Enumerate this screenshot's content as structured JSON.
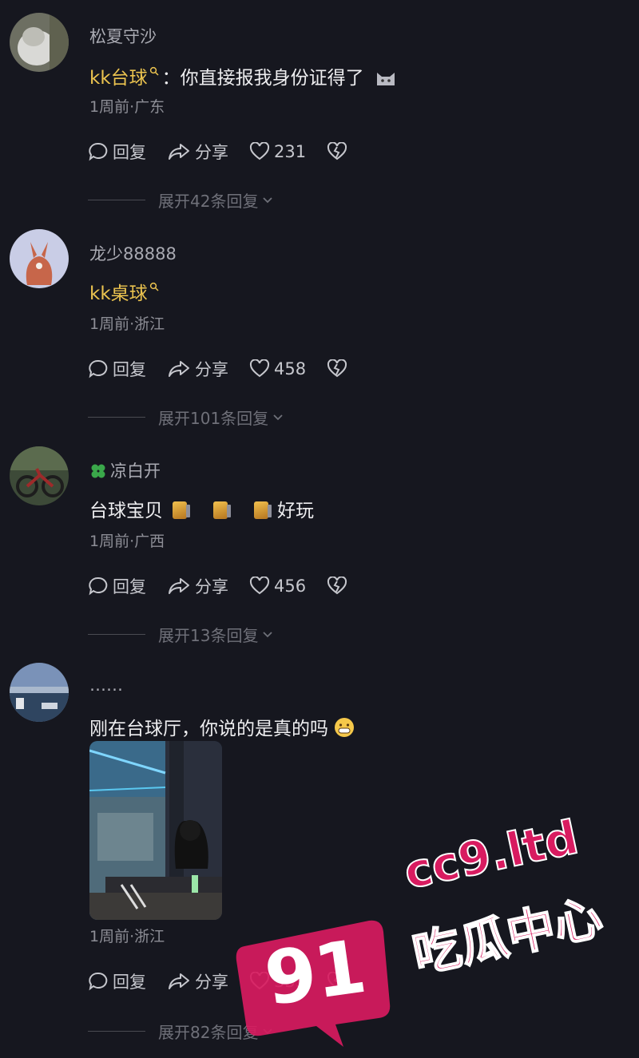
{
  "comments": [
    {
      "username": "松夏守沙",
      "mention": "kk台球",
      "text": "：你直接报我身份证得了",
      "meta": "1周前·广东",
      "actions": {
        "reply": "回复",
        "share": "分享",
        "likes": "231"
      },
      "expand": "展开42条回复"
    },
    {
      "username": "龙少88888",
      "mention": "kk桌球",
      "text": "",
      "meta": "1周前·浙江",
      "actions": {
        "reply": "回复",
        "share": "分享",
        "likes": "458"
      },
      "expand": "展开101条回复"
    },
    {
      "username": "凉白开",
      "text_a": "台球宝贝",
      "text_b": "好玩",
      "meta": "1周前·广西",
      "actions": {
        "reply": "回复",
        "share": "分享",
        "likes": "456"
      },
      "expand": "展开13条回复"
    },
    {
      "username": "……",
      "text": "刚在台球厅，你说的是真的吗",
      "meta": "1周前·浙江",
      "actions": {
        "reply": "回复",
        "share": "分享",
        "likes": "335"
      },
      "expand": "展开82条回复"
    }
  ],
  "watermark": {
    "number": "91",
    "domain": "cc9.ltd",
    "name": "吃瓜中心"
  },
  "colors": {
    "background": "#16171f",
    "mention": "#ebc34f",
    "watermark": "#d81b60"
  }
}
